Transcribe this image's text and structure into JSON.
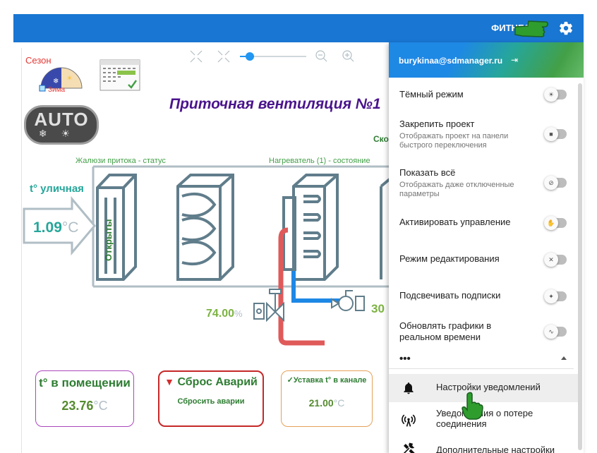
{
  "header": {
    "project": "ФИТНЕС С",
    "gear_icon": "gear-icon"
  },
  "scheme": {
    "season_label": "Сезон",
    "winter_label": "Зима",
    "auto_label": "AUTO",
    "title": "Приточная вентиляция №1",
    "partial_label": "Ско",
    "damper_status": "Жалюзи притока - статус",
    "heater_status": "Нагреватель (1) - состояние",
    "outdoor_label": "t° уличная",
    "outdoor_value": "1.09",
    "outdoor_unit": "°C",
    "damper_state": "Открыты",
    "valve_value": "74.00",
    "valve_unit": "%",
    "pump_value": "30",
    "zoom_level": 0.1
  },
  "cards": {
    "room_title": "t° в помещении",
    "room_value": "23.76",
    "room_unit": "°C",
    "alarm_title": "Сброс Аварий",
    "alarm_sub": "Сбросить аварии",
    "setpoint_title": "✓Уставка t° в канале",
    "setpoint_value": "21.00",
    "setpoint_unit": "°C"
  },
  "panel": {
    "email": "burykinaa@sdmanager.ru",
    "settings": [
      {
        "label": "Тёмный режим",
        "sub": "",
        "icon": "sun-icon",
        "glyph": "☀"
      },
      {
        "label": "Закрепить проект",
        "sub": "Отображать проект на панели быстрого переключения",
        "icon": "bookmark-icon",
        "glyph": "■"
      },
      {
        "label": "Показать всё",
        "sub": "Отображать даже отключенные параметры",
        "icon": "eye-off-icon",
        "glyph": "⊘"
      },
      {
        "label": "Активировать управление",
        "sub": "",
        "icon": "hand-off-icon",
        "glyph": "✋"
      },
      {
        "label": "Режим редактирования",
        "sub": "",
        "icon": "close-icon",
        "glyph": "✕"
      },
      {
        "label": "Подсвечивать подписки",
        "sub": "",
        "icon": "bulb-icon",
        "glyph": "✦"
      },
      {
        "label": "Обновлять графики в реальном времени",
        "sub": "",
        "icon": "chart-icon",
        "glyph": "∿"
      }
    ],
    "more_label": "•••",
    "menu": [
      {
        "label": "Настройки уведомлений",
        "icon": "bell-icon"
      },
      {
        "label": "Уведомления о потере соединения",
        "icon": "antenna-icon"
      },
      {
        "label": "Дополнительные настройки",
        "icon": "tools-icon"
      }
    ]
  }
}
